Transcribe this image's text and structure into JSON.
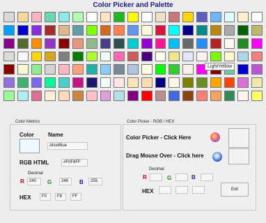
{
  "window": {
    "title": "Color Picker and Palette"
  },
  "palette": {
    "rows": [
      [
        "#D9D9D9",
        "#F7D7A0",
        "#FDB2C0",
        "#66D9B3",
        "#8FE9E9",
        "#B0FFB0",
        "#FFFFFF",
        "#FFE4C4",
        "#1FB91F",
        "#FFFF00",
        "#FFFFFF",
        "#EDE3C2",
        "#C97777",
        "#FFD700",
        "#5E5EC4",
        "#6BB6FF",
        "#E0FFFF",
        "#FFF0D0",
        "#FFFFFF"
      ],
      [
        "#00A0FF",
        "#0000CC",
        "#8A2BE2",
        "#A52A2A",
        "#DEB887",
        "#5F9EA0",
        "#7FFF00",
        "#D2691E",
        "#FF7F50",
        "#6495ED",
        "#FFF8DC",
        "#DC143C",
        "#00FFFF",
        "#00008B",
        "#008B8B",
        "#B8860B",
        "#A9A9A9",
        "#006400",
        "#BDB76B"
      ],
      [
        "#8B008B",
        "#556B2F",
        "#FF8C00",
        "#9932CC",
        "#8B0000",
        "#E9967A",
        "#8FBC8F",
        "#483D8B",
        "#2F4F4F",
        "#00CED1",
        "#9400D3",
        "#FF1493",
        "#00BFFF",
        "#696969",
        "#1E90FF",
        "#B22222",
        "#FFFAF0",
        "#228B22",
        "#FF00FF"
      ],
      [
        "#DCDCDC",
        "#F8F8FF",
        "#FFD700",
        "#DAA520",
        "#808080",
        "#008000",
        "#ADFF2F",
        "#F0FFF0",
        "#FF69B4",
        "#CD5C5C",
        "#4B0082",
        "#FFFFF0",
        "#F0E68C",
        "#E6E6FA",
        "#FFF0F5",
        "#7CFC00",
        "#FFFACD",
        "#ADD8E6",
        "#F08080"
      ],
      [
        "#8B0000",
        "#FAFAD2",
        "#90EE90",
        "#D3D3D3",
        "#FFB6C1",
        "#FFA07A",
        "#20B2AA",
        "#87CEFA",
        "#778899",
        "#B0C4DE",
        "#FFFFE0",
        "#00FF00",
        "#32CD32",
        "#FAF0E6",
        "#FF00FF",
        "#800000",
        "#66CDAA",
        "#0000CD",
        "#BA55D3"
      ],
      [
        "#9370DB",
        "#3CB371",
        "#7B68EE",
        "#00FA9A",
        "#48D1CC",
        "#C71585",
        "#191970",
        "#F5FFFA",
        "#FFE4E1",
        "#FFE4B5",
        "#FFDEAD",
        "#000080",
        "#FDF5E6",
        "#808000",
        "#6B8E23",
        "#FFA500",
        "#FF4500",
        "#DA70D6",
        "#EEE8AA"
      ],
      [
        "#98FB98",
        "#AFEEEE",
        "#DB7093",
        "#FFEFD5",
        "#FFDAB9",
        "#CD853F",
        "#FFC0CB",
        "#DDA0DD",
        "#B0E0E6",
        "#800080",
        "#FF0000",
        "#BC8F8F",
        "#4169E1",
        "#8B4513",
        "#FA8072",
        "#F4A460",
        "#2E8B57",
        "#FFF5EE",
        "#FFFF66"
      ]
    ],
    "tooltip": "LightYellow"
  },
  "metrics": {
    "legend": "Color Metrics",
    "color_label": "Color",
    "name_label": "Name",
    "name_value": "AliceBlue",
    "swatch_color": "#F0F8FF",
    "rgb_html_label": "RGB HTML",
    "rgb_html_value": "#F0F8FF",
    "decimal_label": "Decimal",
    "r_label": "R",
    "g_label": "G",
    "b_label": "B",
    "r_value": "240",
    "g_value": "248",
    "b_value": "255",
    "hex_label": "HEX",
    "hex_r": "F0",
    "hex_g": "F8",
    "hex_b": "FF"
  },
  "picker": {
    "legend": "Color Picker - RGB / HEX",
    "click_label": "Color Picker - Click Here",
    "drag_label": "Drag Mouse Over - Click here",
    "decimal_label": "Decimal",
    "r_label": "R",
    "g_label": "G",
    "b_label": "B",
    "hex_label": "HEX",
    "exit_label": "Exit",
    "colors": {
      "r": "#d40000",
      "g": "#1a8a1a",
      "b": "#1a1ab0"
    }
  }
}
